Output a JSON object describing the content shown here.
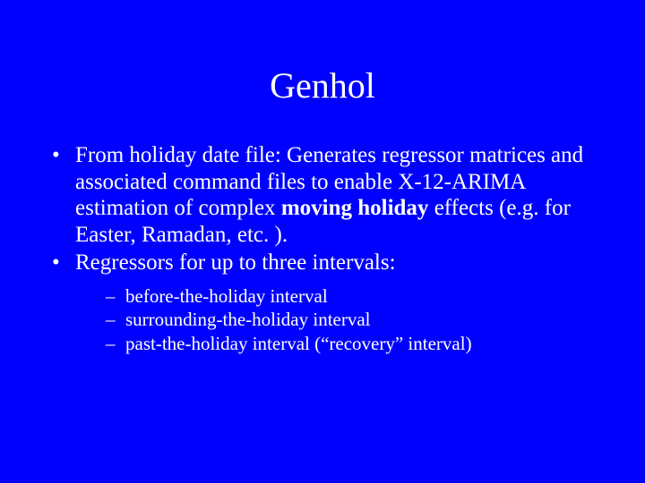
{
  "slide": {
    "title": "Genhol",
    "bullets": [
      {
        "pre": "From holiday date file: Generates  regressor matrices and associated command files to enable X-12-ARIMA estimation of complex ",
        "bold": "moving holiday",
        "post": " effects (e.g. for Easter, Ramadan, etc. )."
      },
      {
        "pre": "Regressors for up to three intervals:",
        "bold": "",
        "post": ""
      }
    ],
    "subbullets": [
      "before-the-holiday interval",
      "surrounding-the-holiday interval",
      "past-the-holiday interval (“recovery” interval)"
    ]
  }
}
